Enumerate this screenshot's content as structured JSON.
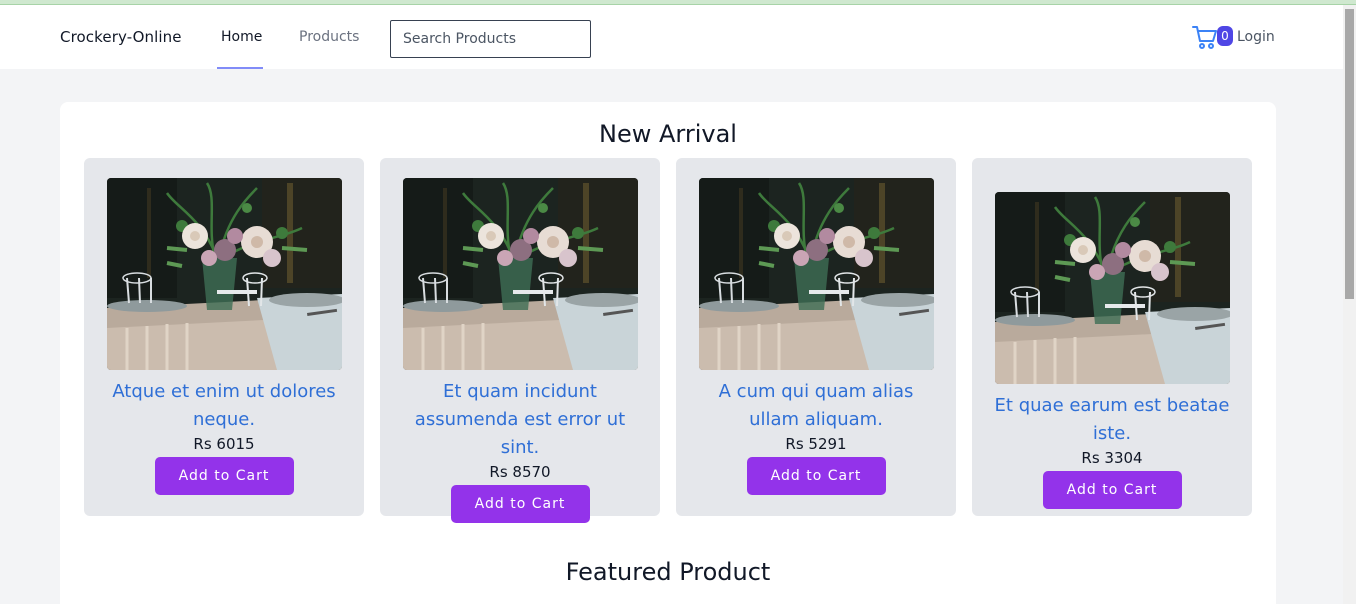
{
  "brand": "Crockery-Online",
  "nav": {
    "home": "Home",
    "products": "Products"
  },
  "search": {
    "placeholder": "Search Products",
    "value": ""
  },
  "cart": {
    "count": "0",
    "icon": "cart-icon"
  },
  "login": "Login",
  "colors": {
    "accent": "#9333ea",
    "link": "#2f6fd6",
    "badge": "#4f46e5",
    "underline": "#818cf8"
  },
  "sections": {
    "new_arrival": "New Arrival",
    "featured": "Featured Product"
  },
  "products": [
    {
      "name": "Atque et enim ut dolores neque.",
      "price": "Rs 6015",
      "button": "Add to Cart"
    },
    {
      "name": "Et quam incidunt assumenda est error ut sint.",
      "price": "Rs 8570",
      "button": "Add to Cart"
    },
    {
      "name": "A cum qui quam alias ullam aliquam.",
      "price": "Rs 5291",
      "button": "Add to Cart"
    },
    {
      "name": "Et quae earum est beatae iste.",
      "price": "Rs 3304",
      "button": "Add to Cart"
    }
  ]
}
